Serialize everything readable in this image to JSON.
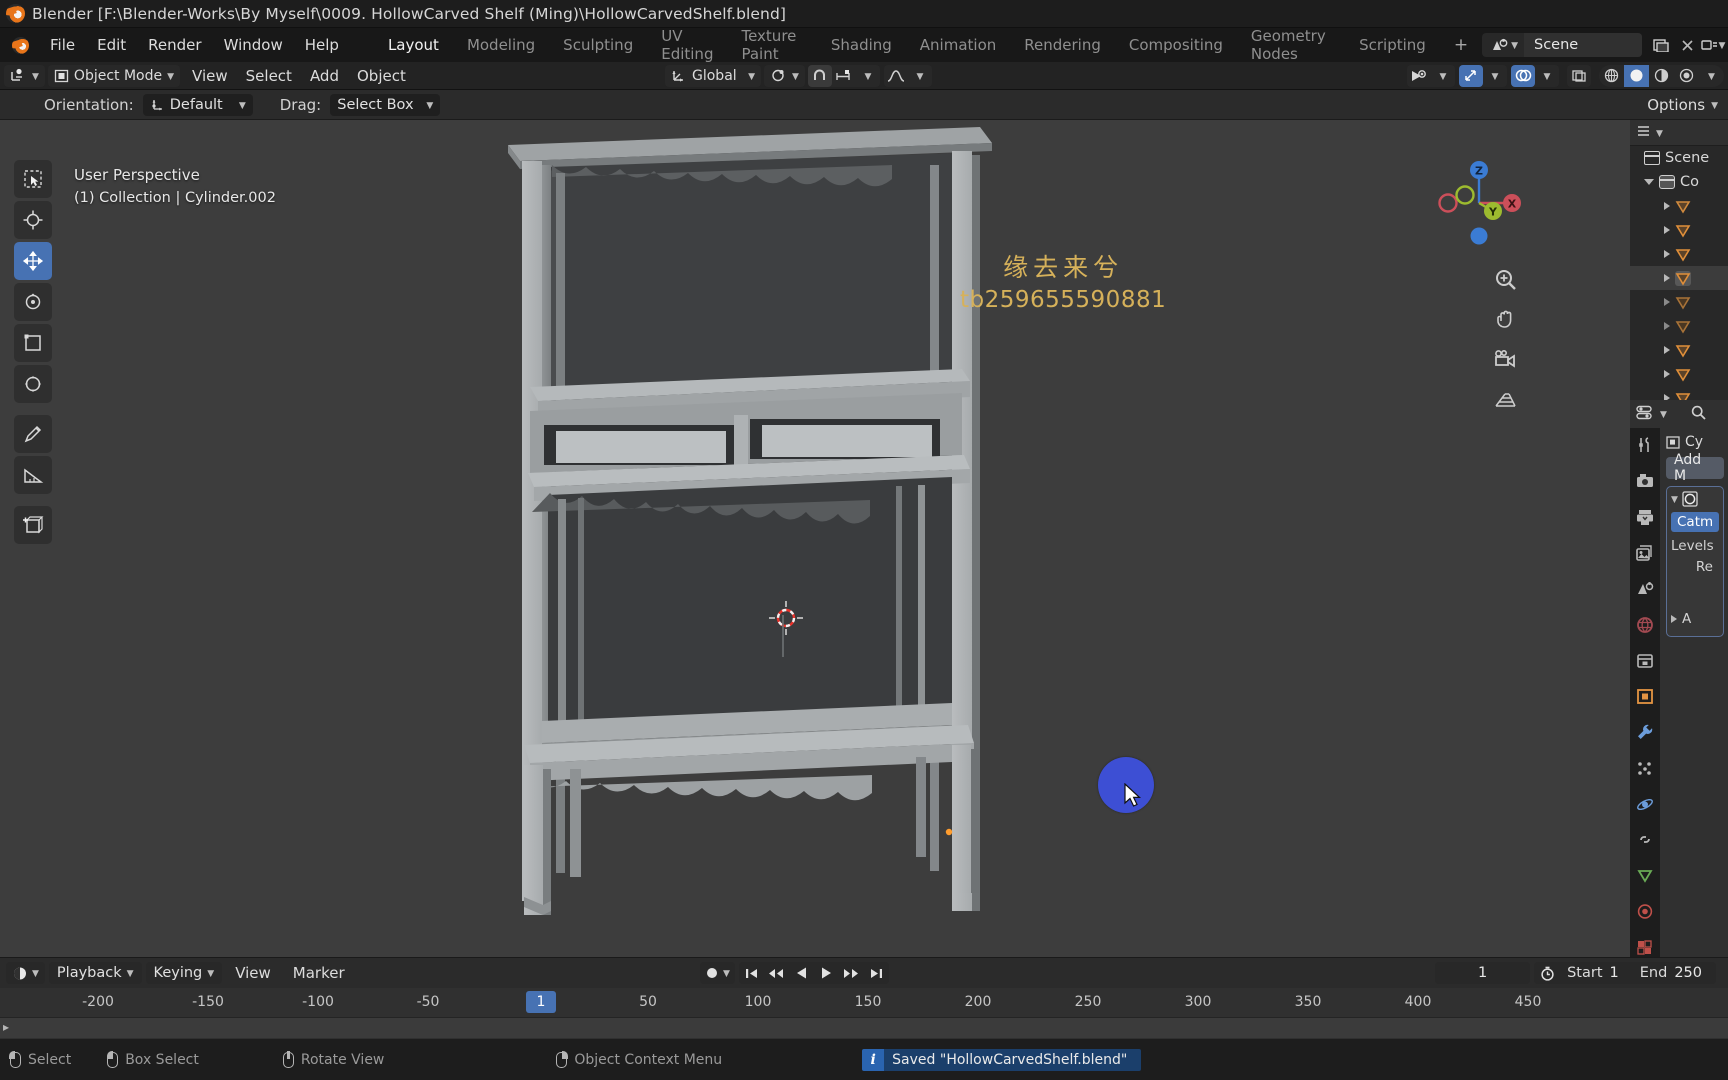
{
  "window": {
    "title": "Blender [F:\\Blender-Works\\By Myself\\0009. HollowCarved Shelf (Ming)\\HollowCarvedShelf.blend]",
    "app_icon": "blender-logo-icon"
  },
  "topbar": {
    "menus": [
      "File",
      "Edit",
      "Render",
      "Window",
      "Help"
    ],
    "workspace_tabs": [
      {
        "label": "Layout",
        "active": true
      },
      {
        "label": "Modeling",
        "active": false
      },
      {
        "label": "Sculpting",
        "active": false
      },
      {
        "label": "UV Editing",
        "active": false
      },
      {
        "label": "Texture Paint",
        "active": false
      },
      {
        "label": "Shading",
        "active": false
      },
      {
        "label": "Animation",
        "active": false
      },
      {
        "label": "Rendering",
        "active": false
      },
      {
        "label": "Compositing",
        "active": false
      },
      {
        "label": "Geometry Nodes",
        "active": false
      },
      {
        "label": "Scripting",
        "active": false
      }
    ],
    "add_workspace": "+",
    "scene_name": "Scene",
    "scene_icon": "scene-data-icon",
    "view_layer_icon": "view-layer-icon"
  },
  "viewport_header": {
    "editor_type_icon": "editor-type-3dview-icon",
    "mode": "Object Mode",
    "mode_icon": "object-mode-icon",
    "menus": [
      "View",
      "Select",
      "Add",
      "Object"
    ],
    "transform_orientation": "Global",
    "orientation_icon": "orientation-axes-icon",
    "pivot_icon": "pivot-point-icon",
    "snap_icon": "snap-magnet-icon",
    "snap_to_icon": "snap-increment-icon",
    "proportional_icon": "proportional-edit-icon",
    "visibility_icon": "object-visibility-icon",
    "gizmo_icon": "gizmo-icon",
    "overlays_icon": "overlays-icon",
    "xray_icon": "xray-toggle-icon",
    "shading_modes": [
      "wireframe",
      "solid",
      "material-preview",
      "rendered"
    ],
    "shading_active": "solid"
  },
  "tool_settings": {
    "orientation_label": "Orientation:",
    "orientation_value": "Default",
    "drag_label": "Drag:",
    "drag_value": "Select Box",
    "options_label": "Options"
  },
  "viewport": {
    "perspective_text": "User Perspective",
    "collection_text": "(1) Collection | Cylinder.002",
    "tools": [
      {
        "name": "tweak-select-box-tool",
        "active": false
      },
      {
        "name": "cursor-tool",
        "active": false
      },
      {
        "name": "move-tool",
        "active": true
      },
      {
        "name": "rotate-tool",
        "active": false
      },
      {
        "name": "scale-tool",
        "active": false
      },
      {
        "name": "transform-tool",
        "active": false
      },
      {
        "name": "annotate-tool",
        "active": false
      },
      {
        "name": "measure-tool",
        "active": false
      },
      {
        "name": "add-cube-tool",
        "active": false
      }
    ],
    "watermark_cn": "缘去来兮",
    "watermark_id": "tb259655590881",
    "gizmo_axes": [
      "X",
      "Y",
      "Z"
    ],
    "nav_buttons": [
      "zoom-icon",
      "pan-hand-icon",
      "camera-view-icon",
      "toggle-perspective-icon"
    ],
    "colors": {
      "background": "#3d3d3d",
      "accent_blue": "#4772b3",
      "axis_x": "#cc4f5a",
      "axis_y": "#9dbb2f",
      "axis_z": "#3b7cd4",
      "blob": "#3d4fd4",
      "watermark": "#d6b15a"
    }
  },
  "outliner": {
    "header_icons": [
      "editor-type-outliner-icon",
      "display-mode-icon",
      "filter-icon",
      "search-icon"
    ],
    "scene_row": "Scene",
    "collection_row": "Co",
    "items": [
      {
        "label": "",
        "icon": "mesh-data-icon",
        "selected": false
      },
      {
        "label": "",
        "icon": "mesh-data-icon",
        "selected": false
      },
      {
        "label": "",
        "icon": "mesh-data-icon",
        "selected": false
      },
      {
        "label": "",
        "icon": "mesh-data-icon",
        "selected": true
      },
      {
        "label": "",
        "icon": "mesh-data-icon",
        "selected": false
      },
      {
        "label": "",
        "icon": "mesh-data-icon",
        "selected": false
      },
      {
        "label": "",
        "icon": "mesh-data-icon",
        "selected": false
      },
      {
        "label": "",
        "icon": "mesh-data-icon",
        "selected": false
      },
      {
        "label": "",
        "icon": "mesh-data-icon",
        "selected": false
      }
    ]
  },
  "properties": {
    "editor_icon": "editor-type-properties-icon",
    "search_icon": "search-icon",
    "tabs": [
      {
        "name": "tool-tab",
        "icon": "tool-wrench-screwdriver-icon"
      },
      {
        "name": "render-tab",
        "icon": "render-camera-icon"
      },
      {
        "name": "output-tab",
        "icon": "output-printer-icon"
      },
      {
        "name": "view-layer-tab",
        "icon": "view-layer-images-icon"
      },
      {
        "name": "scene-tab",
        "icon": "scene-cone-icon"
      },
      {
        "name": "world-tab",
        "icon": "world-globe-icon"
      },
      {
        "name": "collection-tab",
        "icon": "collection-box-icon"
      },
      {
        "name": "object-tab",
        "icon": "object-square-icon"
      },
      {
        "name": "modifiers-tab",
        "icon": "modifier-wrench-icon"
      },
      {
        "name": "particles-tab",
        "icon": "particles-icon"
      },
      {
        "name": "physics-tab",
        "icon": "physics-orbit-icon"
      },
      {
        "name": "constraints-tab",
        "icon": "constraints-icon"
      },
      {
        "name": "data-tab",
        "icon": "object-data-green-triangle-icon"
      },
      {
        "name": "material-tab",
        "icon": "material-sphere-icon"
      },
      {
        "name": "texture-tab",
        "icon": "texture-checker-icon"
      }
    ],
    "breadcrumb_icon": "object-icon",
    "breadcrumb_text": "Cy",
    "add_modifier_label": "Add M",
    "modifier": {
      "expand_icon": "chevron-down-icon",
      "type_icon": "subdivision-surface-icon",
      "subdivision_type": "Catm",
      "levels_label": "Levels",
      "render_label": "Re",
      "advanced_label": "A",
      "advanced_icon": "chevron-right-icon"
    }
  },
  "timeline": {
    "editor_icon": "editor-type-timeline-icon",
    "menus": [
      {
        "label": "Playback",
        "dropdown": true
      },
      {
        "label": "Keying",
        "dropdown": true
      },
      {
        "label": "View",
        "dropdown": false
      },
      {
        "label": "Marker",
        "dropdown": false
      }
    ],
    "auto_key_icon": "record-dot-icon",
    "transport": [
      "jump-to-start-icon",
      "jump-to-prev-keyframe-icon",
      "play-reverse-icon",
      "play-icon",
      "jump-to-next-keyframe-icon",
      "jump-to-end-icon"
    ],
    "current_frame": "1",
    "use_preview_range_icon": "stopwatch-icon",
    "start_label": "Start",
    "start_value": "1",
    "end_label": "End",
    "end_value": "250",
    "ruler_ticks": [
      "-200",
      "-150",
      "-100",
      "-50",
      "50",
      "100",
      "150",
      "200",
      "250",
      "300",
      "350",
      "400",
      "450"
    ],
    "playhead_frame": "1"
  },
  "statusbar": {
    "hints": [
      {
        "icon": "mouse-left-icon",
        "label": "Select"
      },
      {
        "icon": "mouse-left-drag-icon",
        "label": "Box Select"
      },
      {
        "icon": "mouse-middle-icon",
        "label": "Rotate View"
      },
      {
        "icon": "mouse-right-icon",
        "label": "Object Context Menu"
      }
    ],
    "message_icon": "info-icon",
    "message": "Saved \"HollowCarvedShelf.blend\""
  }
}
